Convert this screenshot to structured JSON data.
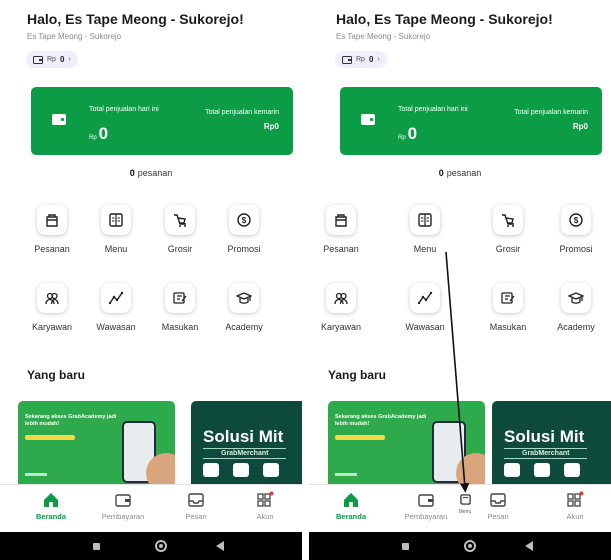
{
  "screens": [
    {
      "greeting": "Halo, Es Tape Meong - Sukorejo!",
      "store_name": "Es Tape Meong - Sukorejo",
      "wallet": {
        "currency": "Rp",
        "amount": "0",
        "chevron": "›"
      },
      "sales": {
        "today_label": "Total penjualan hari ini",
        "today_currency": "Rp",
        "today_value": "0",
        "yesterday_label": "Total penjualan kemarin",
        "yesterday_value": "Rp0"
      },
      "orders": {
        "count": "0",
        "label": "pesanan"
      },
      "menu_row1": [
        {
          "label": "Pesanan",
          "icon": "bag-icon"
        },
        {
          "label": "Menu",
          "icon": "book-icon"
        },
        {
          "label": "Grosir",
          "icon": "cart-icon"
        },
        {
          "label": "Promosi",
          "icon": "dollar-circle-icon"
        }
      ],
      "menu_row2": [
        {
          "label": "Karyawan",
          "icon": "people-icon"
        },
        {
          "label": "Wawasan",
          "icon": "trend-icon"
        },
        {
          "label": "Masukan",
          "icon": "feedback-icon"
        },
        {
          "label": "Academy",
          "icon": "graduation-cap-icon"
        }
      ],
      "section_title": "Yang baru",
      "banner1": {
        "title": "Sekarang akses GrabAcademy jadi lebih mudah!"
      },
      "banner2": {
        "title": "Solusi Mit",
        "subtitle": "GrabMerchant"
      },
      "bottom_nav": [
        {
          "label": "Beranda",
          "icon": "home-icon",
          "active": true
        },
        {
          "label": "Pembayaran",
          "icon": "wallet-icon"
        },
        {
          "label": "Pesan",
          "icon": "inbox-icon"
        },
        {
          "label": "Akun",
          "icon": "grid-icon"
        }
      ]
    },
    {
      "greeting": "Halo, Es Tape Meong - Sukorejo!",
      "store_name": "Es Tape Meong - Sukorejo",
      "wallet": {
        "currency": "Rp",
        "amount": "0",
        "chevron": "›"
      },
      "sales": {
        "today_label": "Total penjualan hari ini",
        "today_currency": "Rp",
        "today_value": "0",
        "yesterday_label": "Total penjualan kemarin",
        "yesterday_value": "Rp0"
      },
      "orders": {
        "count": "0",
        "label": "pesanan"
      },
      "menu_row1": [
        {
          "label": "Pesanan",
          "icon": "bag-icon"
        },
        {
          "label": "Menu",
          "icon": "book-icon"
        },
        {
          "label": "Grosir",
          "icon": "cart-icon"
        },
        {
          "label": "Promosi",
          "icon": "dollar-circle-icon"
        }
      ],
      "menu_row2": [
        {
          "label": "Karyawan",
          "icon": "people-icon"
        },
        {
          "label": "Wawasan",
          "icon": "trend-icon"
        },
        {
          "label": "Masukan",
          "icon": "feedback-icon"
        },
        {
          "label": "Academy",
          "icon": "graduation-cap-icon"
        }
      ],
      "section_title": "Yang baru",
      "banner1": {
        "title": "Sekarang akses GrabAcademy jadi lebih mudah!"
      },
      "banner2": {
        "title": "Solusi Mit",
        "subtitle": "GrabMerchant"
      },
      "bottom_nav": [
        {
          "label": "Beranda",
          "icon": "home-icon",
          "active": true
        },
        {
          "label": "Pembayaran",
          "icon": "wallet-icon"
        },
        {
          "label": "Menu",
          "icon": "menu-doc-icon",
          "inserted": true
        },
        {
          "label": "Pesan",
          "icon": "inbox-icon"
        },
        {
          "label": "Akun",
          "icon": "grid-icon"
        }
      ]
    }
  ],
  "colors": {
    "brand_green": "#0b9c45",
    "banner_green": "#2ea94c",
    "banner_dark": "#0d4a3b",
    "badge_red": "#e53935"
  }
}
